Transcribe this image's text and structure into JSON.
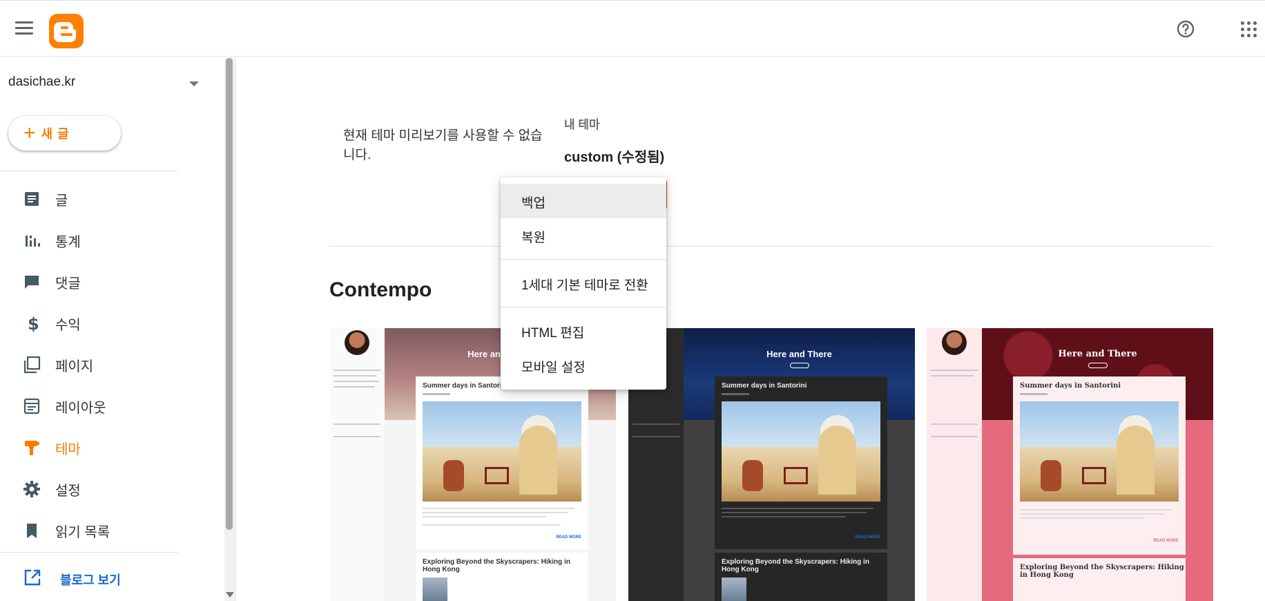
{
  "header": {
    "menu_icon": "hamburger-menu-icon",
    "logo_icon": "blogger-logo-icon",
    "help_icon": "help-circle-icon",
    "apps_icon": "apps-grid-icon",
    "brand_color": "#ff8000"
  },
  "sidebar": {
    "blog_name": "dasichae.kr",
    "new_post": {
      "plus": "+",
      "label": "새 글"
    },
    "items": [
      {
        "label": "글",
        "icon": "posts-icon",
        "active": false
      },
      {
        "label": "통계",
        "icon": "stats-icon",
        "active": false
      },
      {
        "label": "댓글",
        "icon": "comments-icon",
        "active": false
      },
      {
        "label": "수익",
        "icon": "earnings-icon",
        "active": false
      },
      {
        "label": "페이지",
        "icon": "pages-icon",
        "active": false
      },
      {
        "label": "레이아웃",
        "icon": "layout-icon",
        "active": false
      },
      {
        "label": "테마",
        "icon": "theme-icon",
        "active": true
      },
      {
        "label": "설정",
        "icon": "settings-icon",
        "active": false
      },
      {
        "label": "읽기 목록",
        "icon": "reading-list-icon",
        "active": false
      }
    ],
    "view_blog": "블로그 보기",
    "active_color": "#f57c00",
    "link_color": "#1967d2"
  },
  "main": {
    "preview_unavailable": "현재 테마 미리보기를 사용할 수 없습니다.",
    "my_theme_label": "내 테마",
    "current_theme": "custom (수정됨)",
    "section_title": "Contempo",
    "cards": [
      {
        "hero_title": "Here and There",
        "post1_title": "Summer days in Santorini",
        "post2_title": "Exploring Beyond the Skyscrapers: Hiking in Hong Kong",
        "read_more": "READ MORE"
      },
      {
        "hero_title": "Here and There",
        "post1_title": "Summer days in Santorini",
        "post2_title": "Exploring Beyond the Skyscrapers: Hiking in Hong Kong",
        "read_more": "READ MORE"
      },
      {
        "hero_title": "Here and There",
        "post1_title": "Summer days in Santorini",
        "post2_title": "Exploring Beyond the Skyscrapers: Hiking in Hong Kong",
        "read_more": "READ MORE"
      }
    ]
  },
  "menu": {
    "items": [
      {
        "label": "백업"
      },
      {
        "label": "복원"
      },
      {
        "label": "1세대 기본 테마로 전환"
      },
      {
        "label": "HTML 편집"
      },
      {
        "label": "모바일 설정"
      }
    ]
  }
}
